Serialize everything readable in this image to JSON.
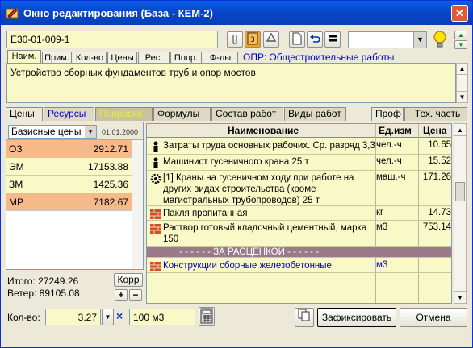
{
  "window": {
    "title": "Окно редактирования (База - КЕМ-2)",
    "close_label": "✕"
  },
  "toolbar": {
    "code_value": "Е30-01-009-1",
    "combo_value": ""
  },
  "subtabs": [
    "Наим.",
    "Прим.",
    "Кол-во",
    "Цены",
    "Рес.",
    "Попр.",
    "Ф-лы"
  ],
  "opr_link": "ОПР: Общестроительные работы",
  "description": "Устройство сборных фундаментов труб и опор мостов",
  "main_tabs": [
    "Цены",
    "Ресурсы",
    "Поправки",
    "Формулы",
    "Состав работ",
    "Виды работ"
  ],
  "right_tabs": [
    "Проф",
    "Тех. часть"
  ],
  "prices": {
    "select_label": "Базисные цены",
    "date": "01.01.2000",
    "rows": [
      {
        "key": "ОЗ",
        "value": "2912.71"
      },
      {
        "key": "ЭМ",
        "value": "17153.88"
      },
      {
        "key": "ЗМ",
        "value": "1425.36"
      },
      {
        "key": "МР",
        "value": "7182.67"
      }
    ],
    "total_label": "Итого: 27249.26",
    "wage_label": "Ветер: 89105.08",
    "corr_label": "Корр"
  },
  "grid": {
    "headers": {
      "name": "Наименование",
      "unit": "Ед.изм",
      "price": "Цена"
    },
    "rows": [
      {
        "icon": "worker-icon",
        "name": "Затраты труда основных рабочих. Ср. разряд 3,3",
        "unit": "чел.-ч",
        "price": "10.65"
      },
      {
        "icon": "worker-icon",
        "name": "Машинист гусеничного крана 25 т",
        "unit": "чел.-ч",
        "price": "15.52"
      },
      {
        "icon": "gear-icon",
        "name": "[1] Краны на гусеничном ходу при работе на других видах строительства (кроме магистральных трубопроводов) 25 т",
        "unit": "маш.-ч",
        "price": "171.26"
      },
      {
        "icon": "brick-icon",
        "name": "Пакля пропитанная",
        "unit": "кг",
        "price": "14.73"
      },
      {
        "icon": "brick-icon",
        "name": "Раствор готовый кладочный цементный, марка 150",
        "unit": "м3",
        "price": "753.14"
      },
      {
        "icon": "",
        "name": "- - - - - - ЗА РАСЦЕНКОЙ - - - - - -",
        "unit": "",
        "price": ""
      },
      {
        "icon": "brick-icon",
        "name": "Конструкции сборные железобетонные",
        "unit": "м3",
        "price": ""
      }
    ]
  },
  "bottom": {
    "qty_label": "Кол-во:",
    "qty_value": "3.27",
    "mult_sign": "×",
    "qty_unit": "100 м3",
    "fix_button": "Зафиксировать",
    "cancel_button": "Отмена"
  }
}
